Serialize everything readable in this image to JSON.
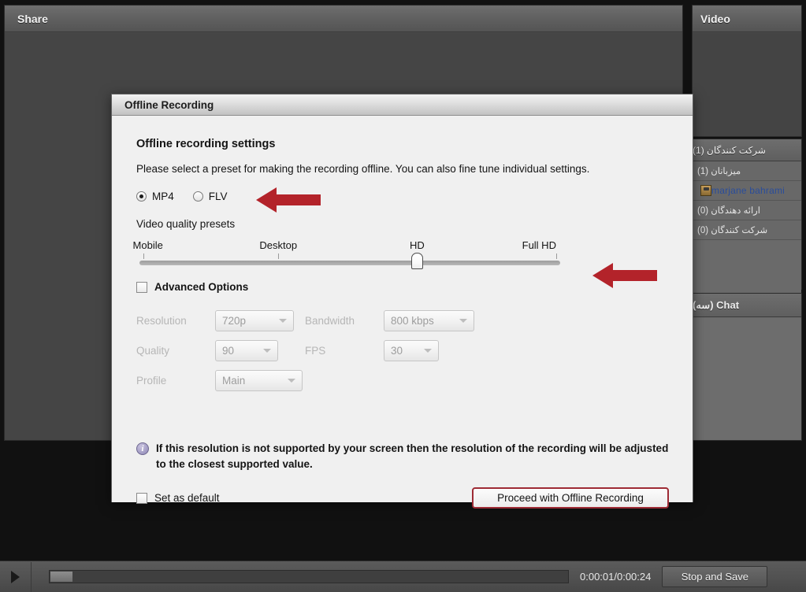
{
  "share_pod": {
    "title": "Share"
  },
  "video_pod": {
    "title": "Video"
  },
  "attendee_pod": {
    "title": "شرکت کنندگان (1)",
    "rows": [
      {
        "label": "میزبانان (1)",
        "type": "group"
      },
      {
        "label": "marjane bahrami",
        "type": "user"
      },
      {
        "label": "ارائه دهندگان (0)",
        "type": "group"
      },
      {
        "label": "شرکت کنندگان (0)",
        "type": "group"
      }
    ]
  },
  "chat_pod": {
    "title": "Chat (سه)"
  },
  "bottom_bar": {
    "play_icon": "play-icon",
    "time": "0:00:01/0:00:24",
    "stop_save_label": "Stop and Save"
  },
  "dialog": {
    "title": "Offline Recording",
    "heading": "Offline recording settings",
    "description": "Please select a preset for making the recording offline. You can also fine tune individual settings.",
    "format": {
      "selected": "MP4",
      "options": [
        {
          "label": "MP4",
          "checked": true
        },
        {
          "label": "FLV",
          "checked": false
        }
      ]
    },
    "presets": {
      "section_label": "Video quality presets",
      "ticks": [
        "Mobile",
        "Desktop",
        "HD",
        "Full HD"
      ],
      "selected_index": 2,
      "selected_label": "HD"
    },
    "advanced": {
      "checkbox_label": "Advanced Options",
      "checked": false,
      "fields": [
        {
          "label": "Resolution",
          "value": "720p"
        },
        {
          "label": "Bandwidth",
          "value": "800 kbps"
        },
        {
          "label": "Quality",
          "value": "90"
        },
        {
          "label": "FPS",
          "value": "30"
        },
        {
          "label": "Profile",
          "value": "Main"
        }
      ]
    },
    "info": {
      "icon": "info-icon",
      "text": "If this resolution is not supported by your screen then the resolution of the recording will be adjusted to the closest supported value."
    },
    "set_default": {
      "label": "Set as default",
      "checked": false
    },
    "proceed_label": "Proceed with Offline Recording"
  },
  "annotations": {
    "arrow_color": "#b3232a",
    "arrows": [
      {
        "name": "arrow-format-selector"
      },
      {
        "name": "arrow-quality-slider"
      }
    ]
  }
}
